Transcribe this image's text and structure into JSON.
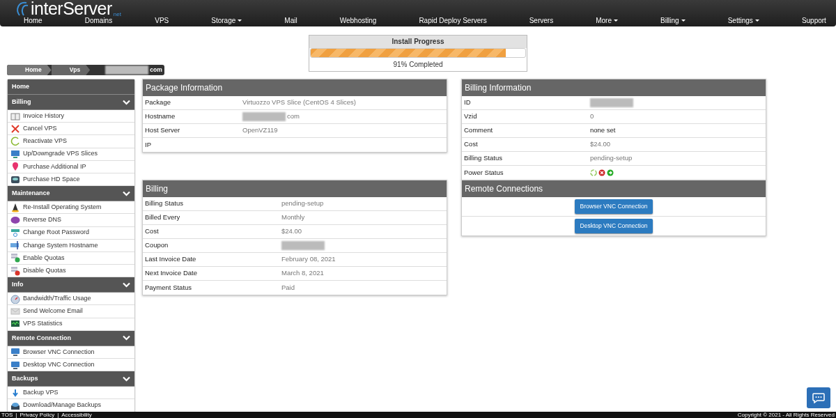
{
  "logo": {
    "main": "interServer",
    "suffix": "net"
  },
  "nav": [
    {
      "label": "Home",
      "dropdown": false
    },
    {
      "label": "Domains",
      "dropdown": false
    },
    {
      "label": "VPS",
      "dropdown": false
    },
    {
      "label": "Storage",
      "dropdown": true
    },
    {
      "label": "Mail",
      "dropdown": false
    },
    {
      "label": "Webhosting",
      "dropdown": false
    },
    {
      "label": "Rapid Deploy Servers",
      "dropdown": false
    },
    {
      "label": "Servers",
      "dropdown": false
    },
    {
      "label": "More",
      "dropdown": true
    },
    {
      "label": "Billing",
      "dropdown": true
    },
    {
      "label": "Settings",
      "dropdown": true
    },
    {
      "label": "Support",
      "dropdown": false
    }
  ],
  "install_progress": {
    "title": "Install Progress",
    "level": 0.91,
    "reading": "91% Completed"
  },
  "breadcrumb": [
    {
      "label": "Home",
      "redacted": false
    },
    {
      "label": "Vps",
      "redacted": false
    },
    {
      "label": "com",
      "redacted": true
    }
  ],
  "sidebar": [
    {
      "title": "Home",
      "collapsible": false
    },
    {
      "title": "Billing",
      "collapsible": true,
      "items": [
        "Invoice History",
        "Cancel VPS",
        "Reactivate VPS",
        "Up/Downgrade VPS Slices",
        "Purchase Additional IP",
        "Purchase HD Space"
      ]
    },
    {
      "title": "Maintenance",
      "collapsible": true,
      "items": [
        "Re-Install Operating System",
        "Reverse DNS",
        "Change Root Password",
        "Change System Hostname",
        "Enable Quotas",
        "Disable Quotas"
      ]
    },
    {
      "title": "Info",
      "collapsible": true,
      "items": [
        "Bandwidth/Traffic Usage",
        "Send Welcome Email",
        "VPS Statistics"
      ]
    },
    {
      "title": "Remote Connection",
      "collapsible": true,
      "items": [
        "Browser VNC Connection",
        "Desktop VNC Connection"
      ]
    },
    {
      "title": "Backups",
      "collapsible": true,
      "items": [
        "Backup VPS",
        "Download/Manage Backups"
      ]
    }
  ],
  "package_information": {
    "title": "Package Information",
    "rows": [
      {
        "label": "Package",
        "value": "Virtuozzo VPS Slice (CentOS 4 Slices)",
        "redacted": false
      },
      {
        "label": "Hostname",
        "value": "com",
        "redacted": true
      },
      {
        "label": "Host Server",
        "value": "OpenVZ119",
        "redacted": false
      },
      {
        "label": "IP",
        "redacted": false
      }
    ]
  },
  "billing_information": {
    "title": "Billing Information",
    "rows": [
      {
        "label": "ID",
        "kind": "text",
        "redacted": true
      },
      {
        "label": "Vzid",
        "value": "0",
        "kind": "text",
        "redacted": false
      },
      {
        "label": "Comment",
        "value": "none set",
        "kind": "dark",
        "redacted": false
      },
      {
        "label": "Cost",
        "value": "$24.00",
        "kind": "text",
        "redacted": false
      },
      {
        "label": "Billing Status",
        "value": "pending-setup",
        "kind": "text",
        "redacted": false
      },
      {
        "label": "Power Status",
        "kind": "power",
        "redacted": false
      }
    ]
  },
  "billing": {
    "title": "Billing",
    "rows": [
      {
        "label": "Billing Status",
        "value": "pending-setup",
        "redacted": false
      },
      {
        "label": "Billed Every",
        "value": "Monthly",
        "redacted": false
      },
      {
        "label": "Cost",
        "value": "$24.00",
        "redacted": false
      },
      {
        "label": "Coupon",
        "redacted": true
      },
      {
        "label": "Last Invoice Date",
        "value": "February 08, 2021",
        "redacted": false
      },
      {
        "label": "Next Invoice Date",
        "value": "March 8, 2021",
        "redacted": false
      },
      {
        "label": "Payment Status",
        "value": "Paid",
        "redacted": false
      }
    ]
  },
  "remote_connections": {
    "title": "Remote Connections",
    "buttons": [
      "Browser VNC Connection",
      "Desktop VNC Connection"
    ]
  },
  "footer": {
    "links": [
      {
        "label": "TOS",
        "kind": "link"
      },
      {
        "label": "|",
        "kind": "separator"
      },
      {
        "label": "Privacy Policy",
        "kind": "link"
      },
      {
        "label": "|",
        "kind": "separator"
      },
      {
        "label": "Accessibility",
        "kind": "link"
      }
    ],
    "copyright": "Copyright © 2021 - All Rights Reserved"
  }
}
